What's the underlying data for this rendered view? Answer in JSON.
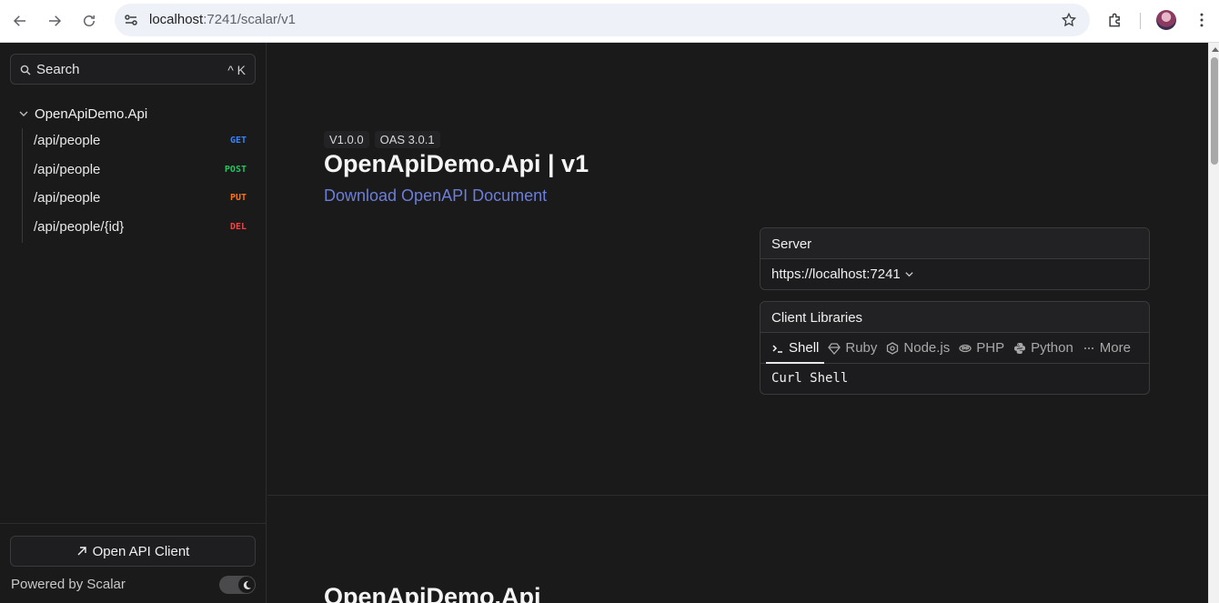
{
  "browser": {
    "url_host": "localhost",
    "url_rest": ":7241/scalar/v1"
  },
  "sidebar": {
    "search_label": "Search",
    "search_shortcut": "^ K",
    "root_label": "OpenApiDemo.Api",
    "operations": [
      {
        "path": "/api/people",
        "method": "GET",
        "color": "#3b82f6"
      },
      {
        "path": "/api/people",
        "method": "POST",
        "color": "#22c55e"
      },
      {
        "path": "/api/people",
        "method": "PUT",
        "color": "#f97316"
      },
      {
        "path": "/api/people/{id}",
        "method": "DEL",
        "color": "#ef4444"
      }
    ],
    "open_client_label": "Open API Client",
    "powered_by": "Powered by Scalar"
  },
  "main": {
    "version_badge": "V1.0.0",
    "oas_badge": "OAS 3.0.1",
    "title": "OpenApiDemo.Api | v1",
    "download_link": "Download OpenAPI Document",
    "server": {
      "heading": "Server",
      "value": "https://localhost:7241"
    },
    "client_libraries": {
      "heading": "Client Libraries",
      "tabs": [
        "Shell",
        "Ruby",
        "Node.js",
        "PHP",
        "Python",
        "More"
      ],
      "active_tab": "Shell",
      "code_label": "Curl Shell"
    },
    "section_title": "OpenApiDemo.Api"
  }
}
